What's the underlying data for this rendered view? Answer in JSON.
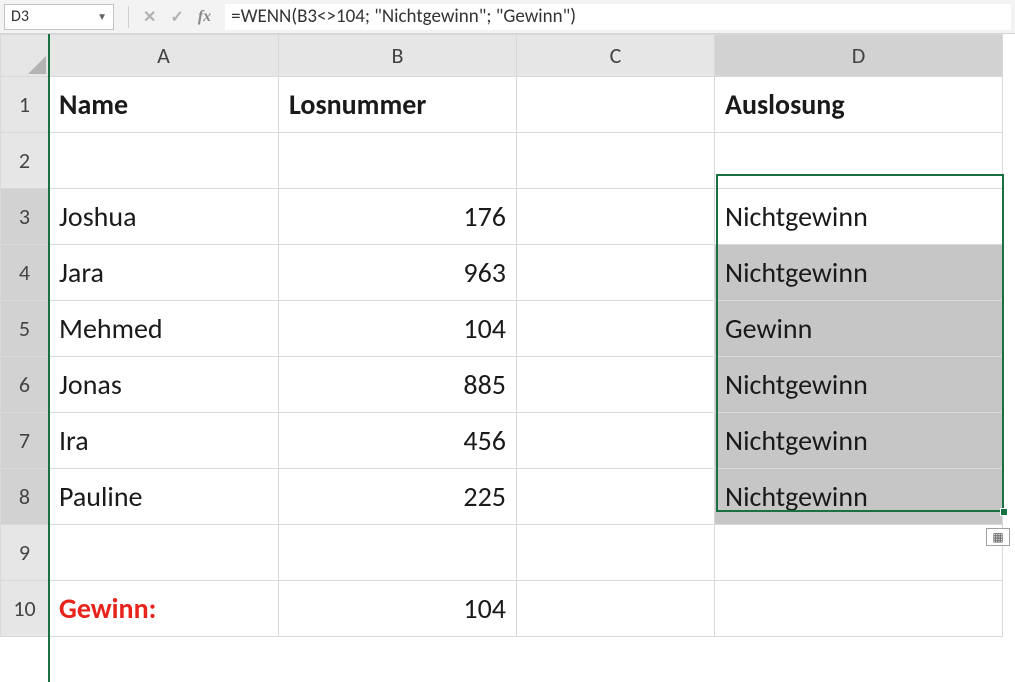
{
  "nameBox": "D3",
  "formula": "=WENN(B3<>104; \"Nichtgewinn\"; \"Gewinn\")",
  "columns": [
    "A",
    "B",
    "C",
    "D"
  ],
  "headers": {
    "A": "Name",
    "B": "Losnummer",
    "C": "",
    "D": "Auslosung"
  },
  "rows": [
    {
      "n": 3,
      "name": "Joshua",
      "los": "176",
      "aus": "Nichtgewinn"
    },
    {
      "n": 4,
      "name": "Jara",
      "los": "963",
      "aus": "Nichtgewinn"
    },
    {
      "n": 5,
      "name": "Mehmed",
      "los": "104",
      "aus": "Gewinn"
    },
    {
      "n": 6,
      "name": "Jonas",
      "los": "885",
      "aus": "Nichtgewinn"
    },
    {
      "n": 7,
      "name": "Ira",
      "los": "456",
      "aus": "Nichtgewinn"
    },
    {
      "n": 8,
      "name": "Pauline",
      "los": "225",
      "aus": "Nichtgewinn"
    }
  ],
  "gewinnLabel": "Gewinn:",
  "gewinnValue": "104"
}
